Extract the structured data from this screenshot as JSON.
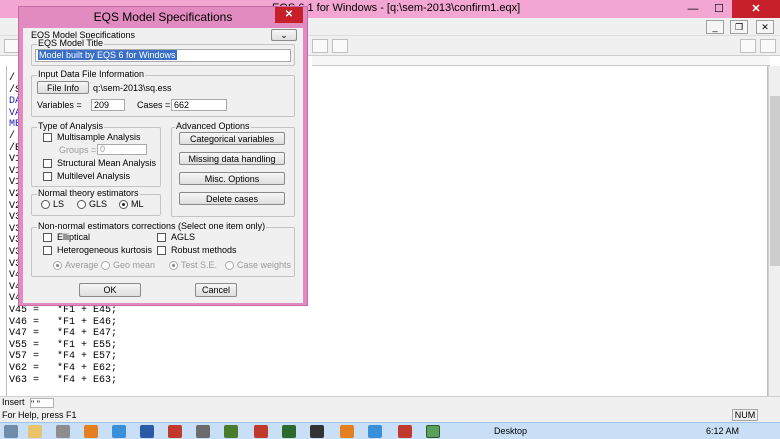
{
  "app": {
    "window_title": "EQS 6.1 for Windows - [q:\\sem-2013\\confirm1.eqx]",
    "minimize_glyph": "—",
    "maximize_glyph": "☐",
    "close_glyph": "✕",
    "mdi_restore_glyph": "❐",
    "mdi_close_glyph": "✕"
  },
  "editor": {
    "lines": [
      "/",
      "/S",
      "DA",
      "VA",
      "ME",
      "/",
      "/E",
      "V1",
      "V1",
      "V1",
      "V2",
      "V2",
      "V3",
      "V3",
      "V3",
      "V3",
      "V3",
      "V4",
      "V4",
      "V4",
      "V45 =   *F1 + E45;",
      "V46 =   *F1 + E46;",
      "V47 =   *F4 + E47;",
      "V55 =   *F1 + E55;",
      "V57 =   *F4 + E57;",
      "V62 =   *F4 + E62;",
      "V63 =   *F4 + E63;"
    ]
  },
  "status": {
    "insert_label": "Insert",
    "insert_value": "\"   \"",
    "help_text": "For Help, press F1",
    "num_indicator": "NUM"
  },
  "taskbar": {
    "desktop_label": "Desktop",
    "clock": "6:12 AM"
  },
  "dialog": {
    "title": "EQS Model Specifications",
    "close_glyph": "✕",
    "model_specs_label": "EQS Model Specifications",
    "model_title_group": "EQS Model Title",
    "model_title_value": "Model built by EQS 6 for Windows",
    "input_file_group": "Input Data File Information",
    "file_info_button": "File Info",
    "file_path": "q:\\sem-2013\\sq.ess",
    "variables_label": "Variables =",
    "variables_value": "209",
    "cases_label": "Cases =",
    "cases_value": "662",
    "type_group": "Type of Analysis",
    "multisample_label": "Multisample Analysis",
    "groups_label": "Groups =",
    "groups_value": "0",
    "structural_label": "Structural Mean Analysis",
    "multilevel_label": "Multilevel Analysis",
    "advanced_group": "Advanced Options",
    "categorical_button": "Categorical variables",
    "missing_button": "Missing data handling",
    "misc_button": "Misc. Options",
    "delete_button": "Delete cases",
    "normal_group": "Normal theory estimators",
    "ls_label": "LS",
    "gls_label": "GLS",
    "ml_label": "ML",
    "selected_estimator": "ML",
    "nonnormal_group": "Non-normal estimators  corrections (Select one item only)",
    "elliptical_label": "Elliptical",
    "agls_label": "AGLS",
    "hetero_label": "Heterogeneous kurtosis",
    "robust_label": "Robust methods",
    "average_label": "Average",
    "geo_mean_label": "Geo mean",
    "test_se_label": "Test S.E.",
    "case_weights_label": "Case weights",
    "ok_button": "OK",
    "cancel_button": "Cancel"
  },
  "colors": {
    "title_bar": "#f4a6d2",
    "dialog_frame": "#e28bc0",
    "close_red": "#c8202a",
    "selection_blue": "#3a6fc7",
    "code_blue": "#1b1bc0"
  }
}
